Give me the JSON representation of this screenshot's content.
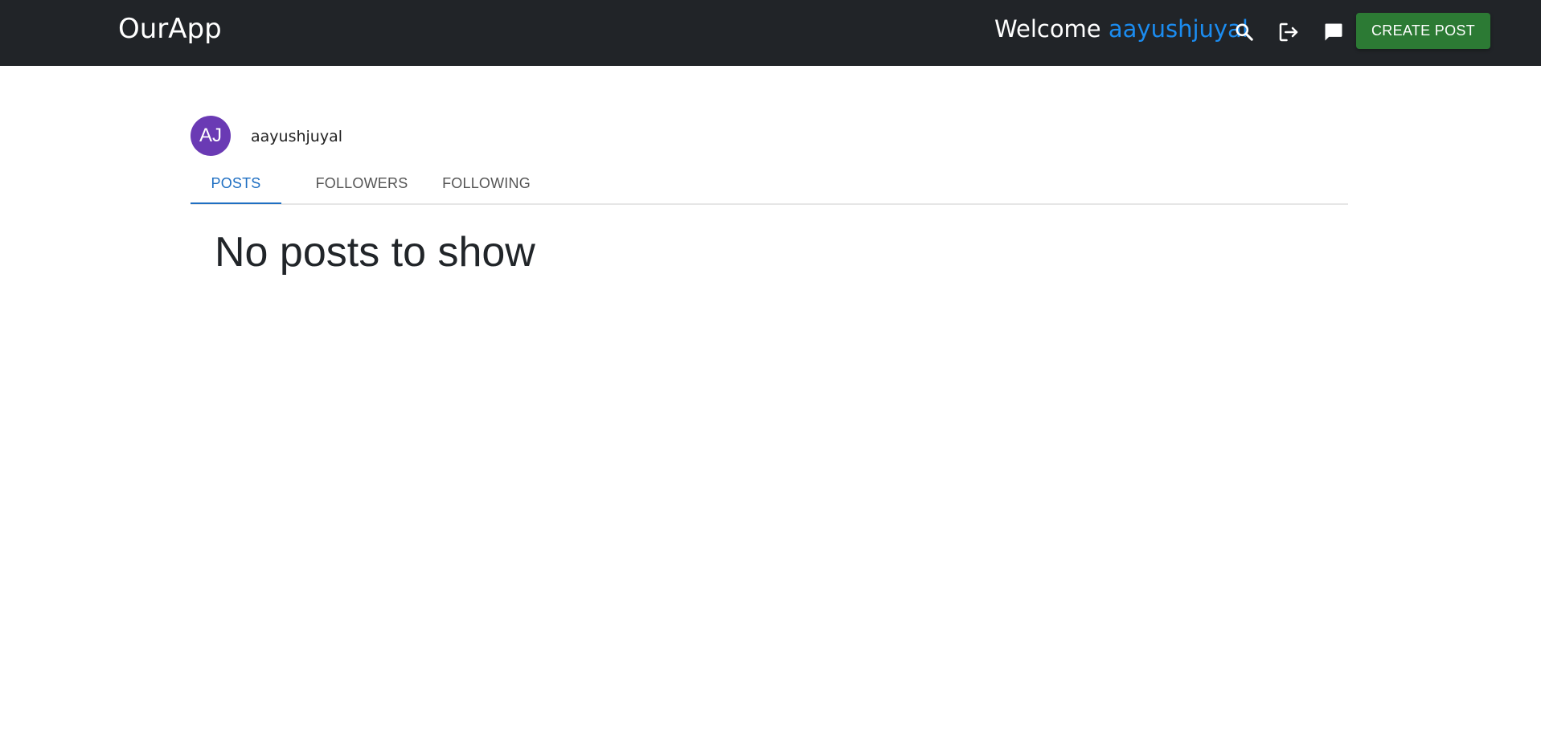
{
  "header": {
    "brand": "OurApp",
    "welcome_text": "Welcome",
    "username": "aayushjuyal",
    "create_post_label": "CREATE POST",
    "icons": [
      "search-icon",
      "logout-icon",
      "chat-icon"
    ],
    "background_color": "#212428",
    "accent_color": "#1b8cf0",
    "button_color": "#2c7a34"
  },
  "profile": {
    "avatar_initials": "AJ",
    "avatar_color": "#6a3ab4",
    "username": "aayushjuyal"
  },
  "tabs": [
    {
      "label": "POSTS",
      "active": true
    },
    {
      "label": "FOLLOWERS",
      "active": false
    },
    {
      "label": "FOLLOWING",
      "active": false
    }
  ],
  "main": {
    "empty_message": "No posts to show"
  }
}
